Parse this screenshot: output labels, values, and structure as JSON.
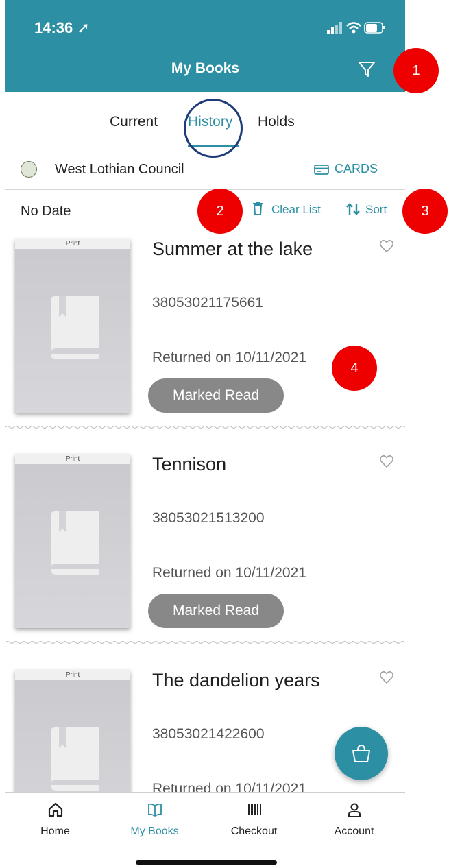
{
  "status": {
    "time": "14:36"
  },
  "header": {
    "title": "My Books"
  },
  "tabs": [
    {
      "label": "Current"
    },
    {
      "label": "History"
    },
    {
      "label": "Holds"
    }
  ],
  "library": {
    "name": "West Lothian Council",
    "cards_label": "CARDS"
  },
  "sort_row": {
    "date_label": "No Date",
    "clear_label": "Clear List",
    "sort_label": "Sort"
  },
  "books": [
    {
      "format": "Print",
      "title": "Summer at the lake",
      "barcode": "38053021175661",
      "returned": "Returned on 10/11/2021",
      "badge": "Marked Read"
    },
    {
      "format": "Print",
      "title": "Tennison",
      "barcode": "38053021513200",
      "returned": "Returned on 10/11/2021",
      "badge": "Marked Read"
    },
    {
      "format": "Print",
      "title": "The dandelion years",
      "barcode": "38053021422600",
      "returned": "Returned on 10/11/2021"
    }
  ],
  "nav": [
    {
      "label": "Home"
    },
    {
      "label": "My Books"
    },
    {
      "label": "Checkout"
    },
    {
      "label": "Account"
    }
  ],
  "markers": [
    "1",
    "2",
    "3",
    "4"
  ],
  "colors": {
    "accent": "#2d8fa3",
    "badge": "#888888",
    "marker": "#ee0000"
  }
}
